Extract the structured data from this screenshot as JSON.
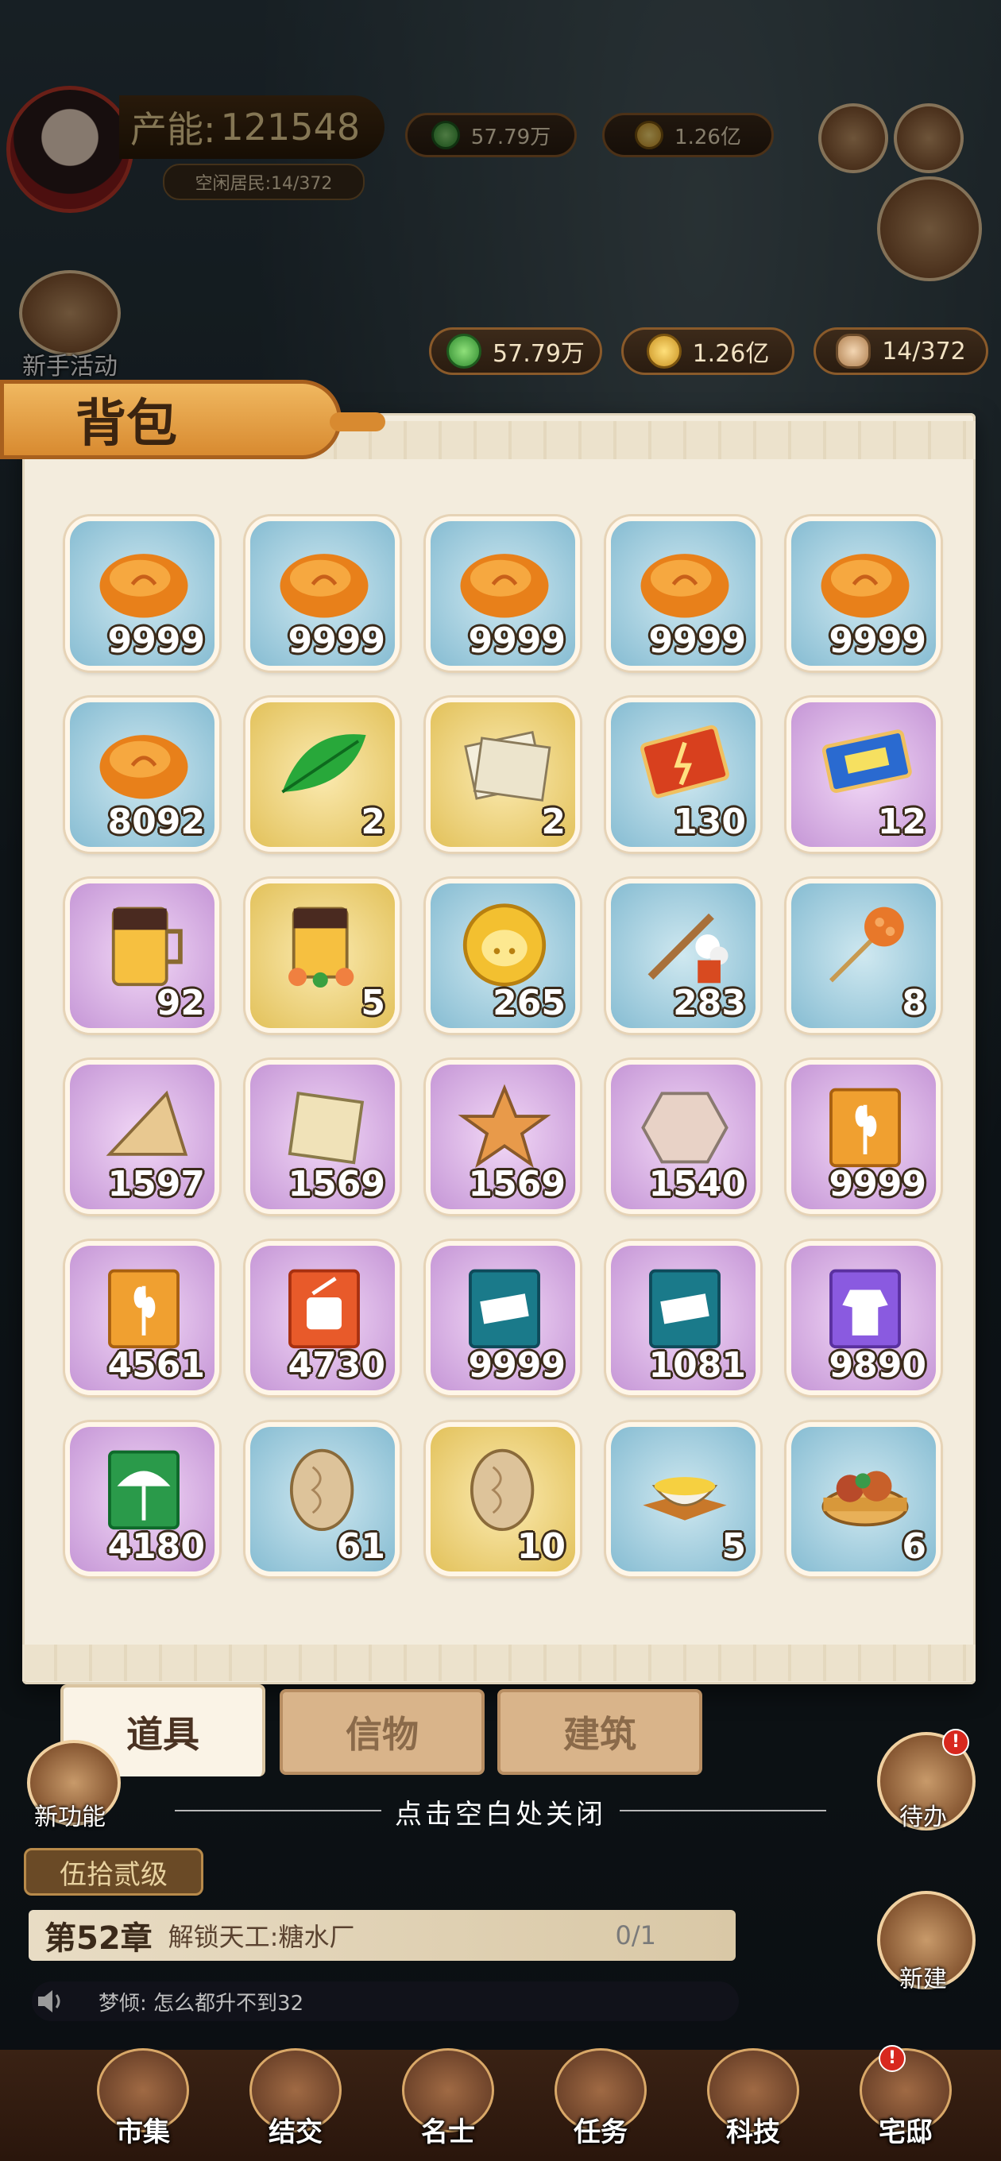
{
  "hud": {
    "production_label": "产能:",
    "production_value": "121548",
    "idle_residents": "空闲居民:14/372",
    "top_copper": "57.79万",
    "top_gold": "1.26亿"
  },
  "resources": {
    "copper": "57.79万",
    "gold": "1.26亿",
    "workers": "14/372"
  },
  "side": {
    "newbie_event": "新手活动",
    "new_feature": "新功能",
    "todo": "待办",
    "build": "新建"
  },
  "panel": {
    "title": "背包",
    "close_hint": "点击空白处关闭",
    "tabs": [
      {
        "label": "道具",
        "active": true
      },
      {
        "label": "信物",
        "active": false
      },
      {
        "label": "建筑",
        "active": false
      }
    ]
  },
  "items": [
    {
      "icon": "orange-bun-icon",
      "bg": "blue",
      "count": "9999"
    },
    {
      "icon": "orange-bun-icon",
      "bg": "blue",
      "count": "9999"
    },
    {
      "icon": "orange-bun-icon",
      "bg": "blue",
      "count": "9999"
    },
    {
      "icon": "orange-bun-icon",
      "bg": "blue",
      "count": "9999"
    },
    {
      "icon": "orange-bun-icon",
      "bg": "blue",
      "count": "9999"
    },
    {
      "icon": "orange-bun-icon",
      "bg": "blue",
      "count": "8092"
    },
    {
      "icon": "green-leaf-icon",
      "bg": "yellow",
      "count": "2"
    },
    {
      "icon": "paper-scroll-icon",
      "bg": "yellow",
      "count": "2"
    },
    {
      "icon": "lightning-ticket-icon",
      "bg": "blue",
      "count": "130"
    },
    {
      "icon": "sweep-ticket-icon",
      "bg": "purple",
      "count": "12"
    },
    {
      "icon": "beer-mug-icon",
      "bg": "purple",
      "count": "92"
    },
    {
      "icon": "beer-mug-flowers-icon",
      "bg": "yellow",
      "count": "5"
    },
    {
      "icon": "pig-coin-icon",
      "bg": "blue",
      "count": "265"
    },
    {
      "icon": "firecracker-stick-icon",
      "bg": "blue",
      "count": "283"
    },
    {
      "icon": "candy-stick-icon",
      "bg": "blue",
      "count": "8"
    },
    {
      "icon": "wood-triangle-icon",
      "bg": "purple",
      "count": "1597"
    },
    {
      "icon": "wood-square-icon",
      "bg": "purple",
      "count": "1569"
    },
    {
      "icon": "wood-star-icon",
      "bg": "purple",
      "count": "1569"
    },
    {
      "icon": "stone-hexagon-icon",
      "bg": "purple",
      "count": "1540"
    },
    {
      "icon": "wheat-book-icon",
      "bg": "purple",
      "count": "9999"
    },
    {
      "icon": "wheat-book-icon",
      "bg": "purple",
      "count": "4561"
    },
    {
      "icon": "drum-book-icon",
      "bg": "purple",
      "count": "4730"
    },
    {
      "icon": "cloth-book-icon",
      "bg": "purple",
      "count": "9999"
    },
    {
      "icon": "cloth-book-icon",
      "bg": "purple",
      "count": "1081"
    },
    {
      "icon": "robe-book-icon",
      "bg": "purple",
      "count": "9890"
    },
    {
      "icon": "umbrella-book-icon",
      "bg": "purple",
      "count": "4180"
    },
    {
      "icon": "walnut-icon",
      "bg": "blue",
      "count": "61"
    },
    {
      "icon": "walnut-icon",
      "bg": "yellow",
      "count": "10"
    },
    {
      "icon": "rice-bowl-icon",
      "bg": "blue",
      "count": "5"
    },
    {
      "icon": "steamer-food-icon",
      "bg": "blue",
      "count": "6"
    }
  ],
  "bottom": {
    "level": "伍拾贰级",
    "chapter_no": "第52章",
    "chapter_task": "解锁天工:糖水厂",
    "chapter_progress": "0/1",
    "chat": "梦倾: 怎么都升不到32"
  },
  "nav": [
    "市集",
    "结交",
    "名士",
    "任务",
    "科技",
    "宅邸"
  ],
  "colors": {
    "panel": "#f3ecdd",
    "title_banner": "#d88a30",
    "slot_blue": "#86bcd2",
    "slot_yellow": "#e2c15a",
    "slot_purple": "#c596d6"
  }
}
